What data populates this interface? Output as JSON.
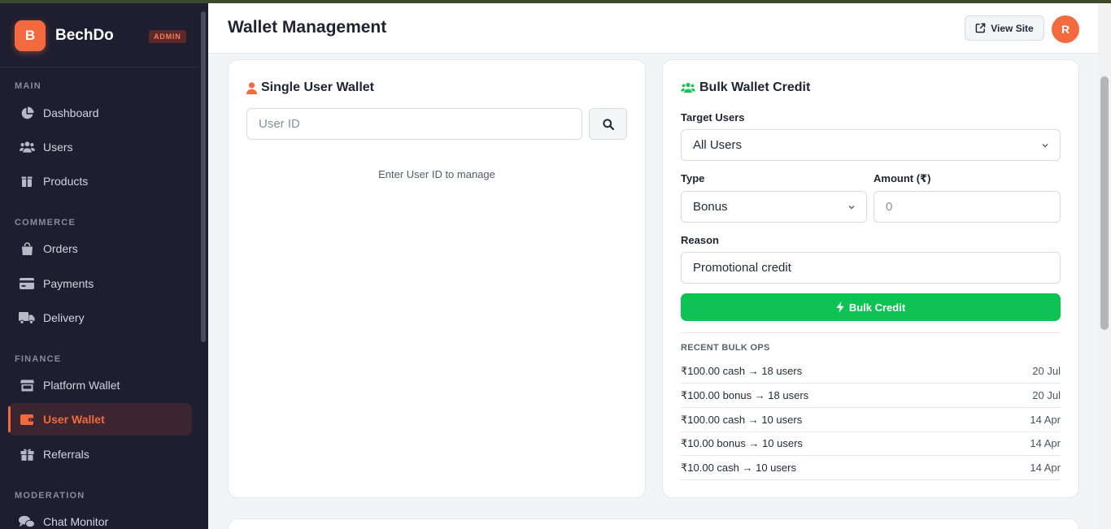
{
  "brand": {
    "initial": "B",
    "name": "BechDo",
    "badge": "ADMIN"
  },
  "sidebar": {
    "sections": [
      {
        "label": "MAIN"
      },
      {
        "label": "COMMERCE"
      },
      {
        "label": "FINANCE"
      },
      {
        "label": "MODERATION"
      }
    ],
    "items": [
      {
        "label": "Dashboard",
        "icon": "pie-chart-icon"
      },
      {
        "label": "Users",
        "icon": "users-icon"
      },
      {
        "label": "Products",
        "icon": "box-icon"
      },
      {
        "label": "Orders",
        "icon": "shopping-bag-icon"
      },
      {
        "label": "Payments",
        "icon": "credit-card-icon"
      },
      {
        "label": "Delivery",
        "icon": "truck-icon"
      },
      {
        "label": "Platform Wallet",
        "icon": "store-icon"
      },
      {
        "label": "User Wallet",
        "icon": "wallet-icon",
        "active": true
      },
      {
        "label": "Referrals",
        "icon": "gift-icon"
      },
      {
        "label": "Chat Monitor",
        "icon": "chat-icon"
      }
    ],
    "active_color": "#f26a3d"
  },
  "header": {
    "title": "Wallet Management",
    "view_site": "View Site",
    "avatar_initial": "R"
  },
  "single_wallet": {
    "title": "Single User Wallet",
    "placeholder": "User ID",
    "hint": "Enter User ID to manage"
  },
  "bulk_credit": {
    "title": "Bulk Wallet Credit",
    "target_label": "Target Users",
    "target_value": "All Users",
    "type_label": "Type",
    "type_value": "Bonus",
    "amount_label": "Amount (₹)",
    "amount_placeholder": "0",
    "reason_label": "Reason",
    "reason_value": "Promotional credit",
    "button_label": "Bulk Credit",
    "button_color": "#0ec254",
    "recent_title": "RECENT BULK OPS",
    "recent": [
      {
        "text": "₹100.00 cash → 18 users",
        "date": "20 Jul"
      },
      {
        "text": "₹100.00 bonus → 18 users",
        "date": "20 Jul"
      },
      {
        "text": "₹100.00 cash → 10 users",
        "date": "14 Apr"
      },
      {
        "text": "₹10.00 bonus → 10 users",
        "date": "14 Apr"
      },
      {
        "text": "₹10.00 cash → 10 users",
        "date": "14 Apr"
      }
    ]
  }
}
